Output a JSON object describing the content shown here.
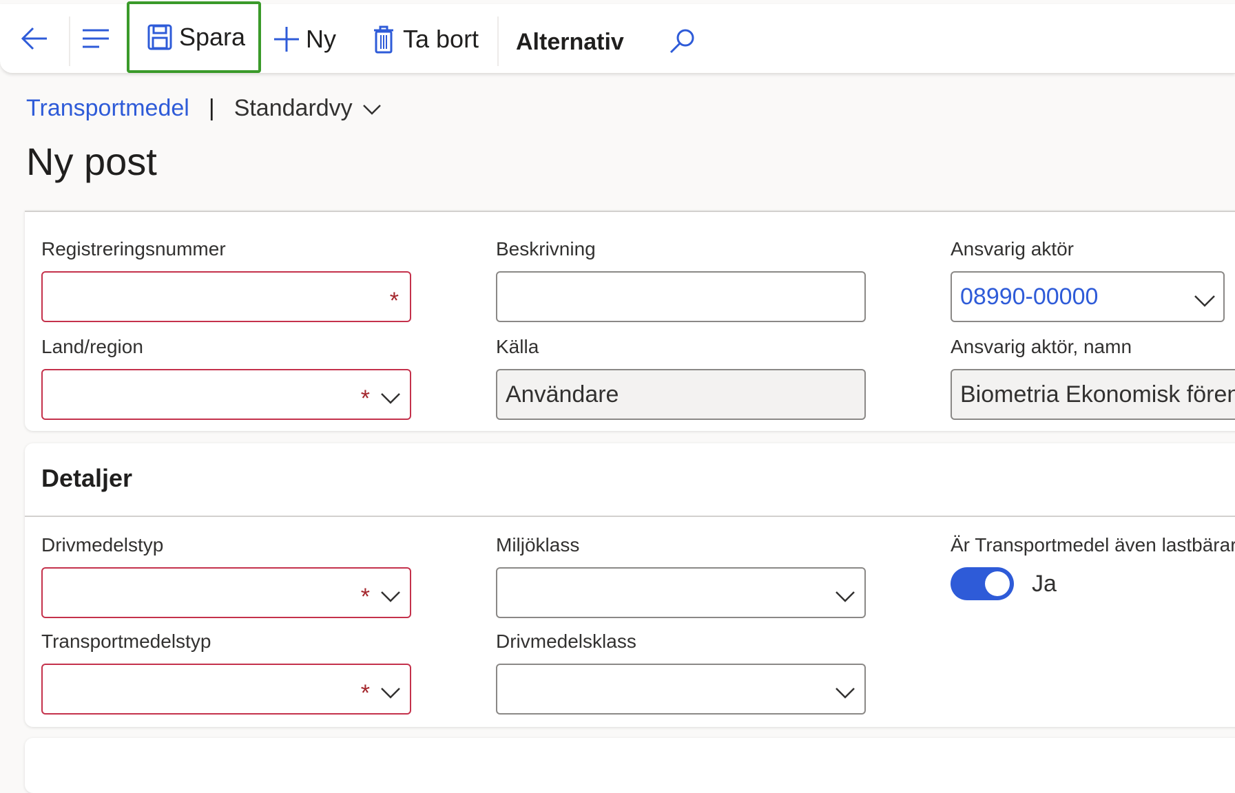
{
  "toolbar": {
    "save_label": "Spara",
    "new_label": "Ny",
    "delete_label": "Ta bort",
    "options_label": "Alternativ",
    "highlight_color": "#3a9a2a"
  },
  "breadcrumb": {
    "link": "Transportmedel",
    "separator": "|",
    "view": "Standardvy"
  },
  "page": {
    "title": "Ny post"
  },
  "general": {
    "reg_number": {
      "label": "Registreringsnummer",
      "value": "",
      "required": "*"
    },
    "description": {
      "label": "Beskrivning",
      "value": ""
    },
    "responsible_actor": {
      "label": "Ansvarig aktör",
      "value": "08990-00000"
    },
    "country_region": {
      "label": "Land/region",
      "value": "",
      "required": "*"
    },
    "source": {
      "label": "Källa",
      "value": "Användare"
    },
    "responsible_actor_name": {
      "label": "Ansvarig aktör, namn",
      "value": "Biometria Ekonomisk förening"
    }
  },
  "details": {
    "title": "Detaljer",
    "fuel_type": {
      "label": "Drivmedelstyp",
      "value": "",
      "required": "*"
    },
    "environment_class": {
      "label": "Miljöklass",
      "value": ""
    },
    "is_load_carrier": {
      "label": "Är Transportmedel även lastbärare",
      "value": "Ja"
    },
    "transport_type": {
      "label": "Transportmedelstyp",
      "value": "",
      "required": "*"
    },
    "fuel_class": {
      "label": "Drivmedelsklass",
      "value": ""
    }
  },
  "colors": {
    "accent": "#2e5bd8",
    "required_border": "#c4314b"
  }
}
